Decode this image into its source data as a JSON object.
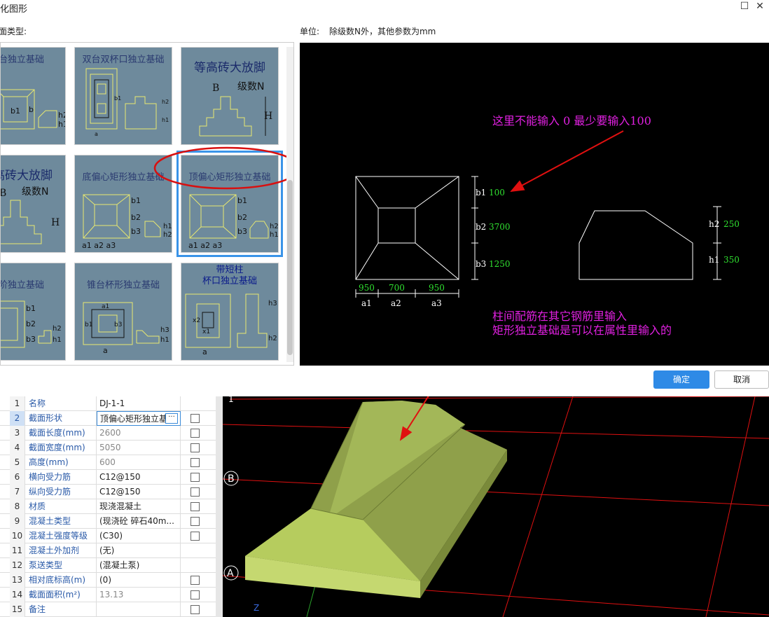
{
  "window": {
    "title": "参数化图形",
    "maximize_glyph": "☐",
    "close_glyph": "✕"
  },
  "section_label": "截面类型:",
  "unit_label": "单位:",
  "unit_text": "除级数N外，其他参数为mm",
  "tiles": [
    {
      "name": "双台独立基础"
    },
    {
      "name": "双台双杯口独立基础"
    },
    {
      "name": "等高砖大放脚",
      "level_label": "级数N"
    },
    {
      "name": "等高砖大放脚",
      "level_label": "级数N"
    },
    {
      "name": "底偏心矩形独立基础"
    },
    {
      "name": "顶偏心矩形独立基础"
    },
    {
      "name": "二阶独立基础"
    },
    {
      "name": "锥台杯形独立基础"
    },
    {
      "name_line1": "带短柱",
      "name_line2": "杯口独立基础"
    }
  ],
  "cad": {
    "annotation1": "这里不能输入  0    最少要输入100",
    "annotation2_line1": "柱间配筋在其它钢筋里输入",
    "annotation2_line2": "矩形独立基础是可以在属性里输入的",
    "b1_label": "b1",
    "b1_value": "100",
    "b2_label": "b2",
    "b2_value": "3700",
    "b3_label": "b3",
    "b3_value": "1250",
    "a1_label": "a1",
    "a1_value": "950",
    "a2_label": "a2",
    "a2_value": "700",
    "a3_label": "a3",
    "a3_value": "950",
    "h2_label": "h2",
    "h2_value": "250",
    "h1_label": "h1",
    "h1_value": "350",
    "colors": {
      "annotation": "#e020e0",
      "value": "#30e030",
      "arrow": "#e01010",
      "line": "#ffffff"
    }
  },
  "buttons": {
    "ok": "确定",
    "cancel": "取消"
  },
  "properties": [
    {
      "num": "1",
      "name": "名称",
      "value": "DJ-1-1",
      "checkbox": false
    },
    {
      "num": "2",
      "name": "截面形状",
      "value": "顶偏心矩形独立基础",
      "checkbox": true,
      "highlight": true
    },
    {
      "num": "3",
      "name": "截面长度(mm)",
      "value": "2600",
      "checkbox": true,
      "gray": true
    },
    {
      "num": "4",
      "name": "截面宽度(mm)",
      "value": "5050",
      "checkbox": true,
      "gray": true
    },
    {
      "num": "5",
      "name": "高度(mm)",
      "value": "600",
      "checkbox": true,
      "gray": true
    },
    {
      "num": "6",
      "name": "横向受力筋",
      "value": "C12@150",
      "checkbox": true
    },
    {
      "num": "7",
      "name": "纵向受力筋",
      "value": "C12@150",
      "checkbox": true
    },
    {
      "num": "8",
      "name": "材质",
      "value": "现浇混凝土",
      "checkbox": true
    },
    {
      "num": "9",
      "name": "混凝土类型",
      "value": "(现浇砼 碎石40m...",
      "checkbox": true
    },
    {
      "num": "10",
      "name": "混凝土强度等级",
      "value": "(C30)",
      "checkbox": true
    },
    {
      "num": "11",
      "name": "混凝土外加剂",
      "value": "(无)",
      "checkbox": false
    },
    {
      "num": "12",
      "name": "泵送类型",
      "value": "(混凝土泵)",
      "checkbox": false
    },
    {
      "num": "13",
      "name": "相对底标高(m)",
      "value": "(0)",
      "checkbox": true
    },
    {
      "num": "14",
      "name": "截面面积(m²)",
      "value": "13.13",
      "checkbox": true,
      "gray": true
    },
    {
      "num": "15",
      "name": "备注",
      "value": "",
      "checkbox": true
    }
  ],
  "view3d": {
    "axis_labels": [
      "1",
      "B",
      "A"
    ],
    "z_label": "Z",
    "colors": {
      "top": "#8fa04a",
      "side": "#b6cc5e",
      "front": "#c5d870",
      "grid": "#e01010"
    }
  }
}
